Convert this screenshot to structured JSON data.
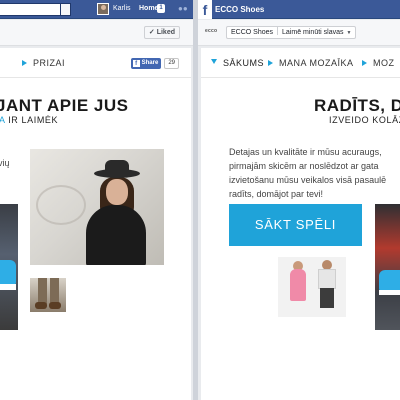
{
  "left_window": {
    "fb_bar": {
      "user_name": "Karlis",
      "home_label": "Home",
      "home_badge": "1"
    },
    "page_strip": {
      "liked_label": "Liked"
    },
    "nav": {
      "item_prizes": "PRIZAI"
    },
    "share": {
      "label": "Share",
      "count": "29"
    },
    "content": {
      "headline": "JANT APIE JUS",
      "subhead_highlight": "A",
      "subhead_rest": " IR LAIMĖK",
      "para_fragment": "vių"
    }
  },
  "right_window": {
    "fb_bar": {
      "page_title": "ECCO Shoes"
    },
    "page_strip": {
      "brand_mini": "ecco",
      "select_page": "ECCO Shoes",
      "select_tab": "Laimē minūti slavas"
    },
    "nav": {
      "item_home": "SĀKUMS",
      "item_mosaic": "MANA MOZAĪKA",
      "item_cut": "MOZ"
    },
    "content": {
      "headline": "RADĪTS, DON",
      "subhead": "IZVEIDO KOLĀŽ",
      "para_lines": [
        "Detajas un kvalitāte ir mūsu acuraugs,",
        "pirmajām skicēm ar noslēdzot ar gata",
        "izvietošanu mūsu veikalos visā pasaulē",
        "radīts, domājot par tevi!"
      ],
      "cta_label": "SĀKT SPĒLI"
    }
  },
  "colors": {
    "facebook_blue": "#3b5998",
    "accent_cyan": "#1fa3d9"
  }
}
